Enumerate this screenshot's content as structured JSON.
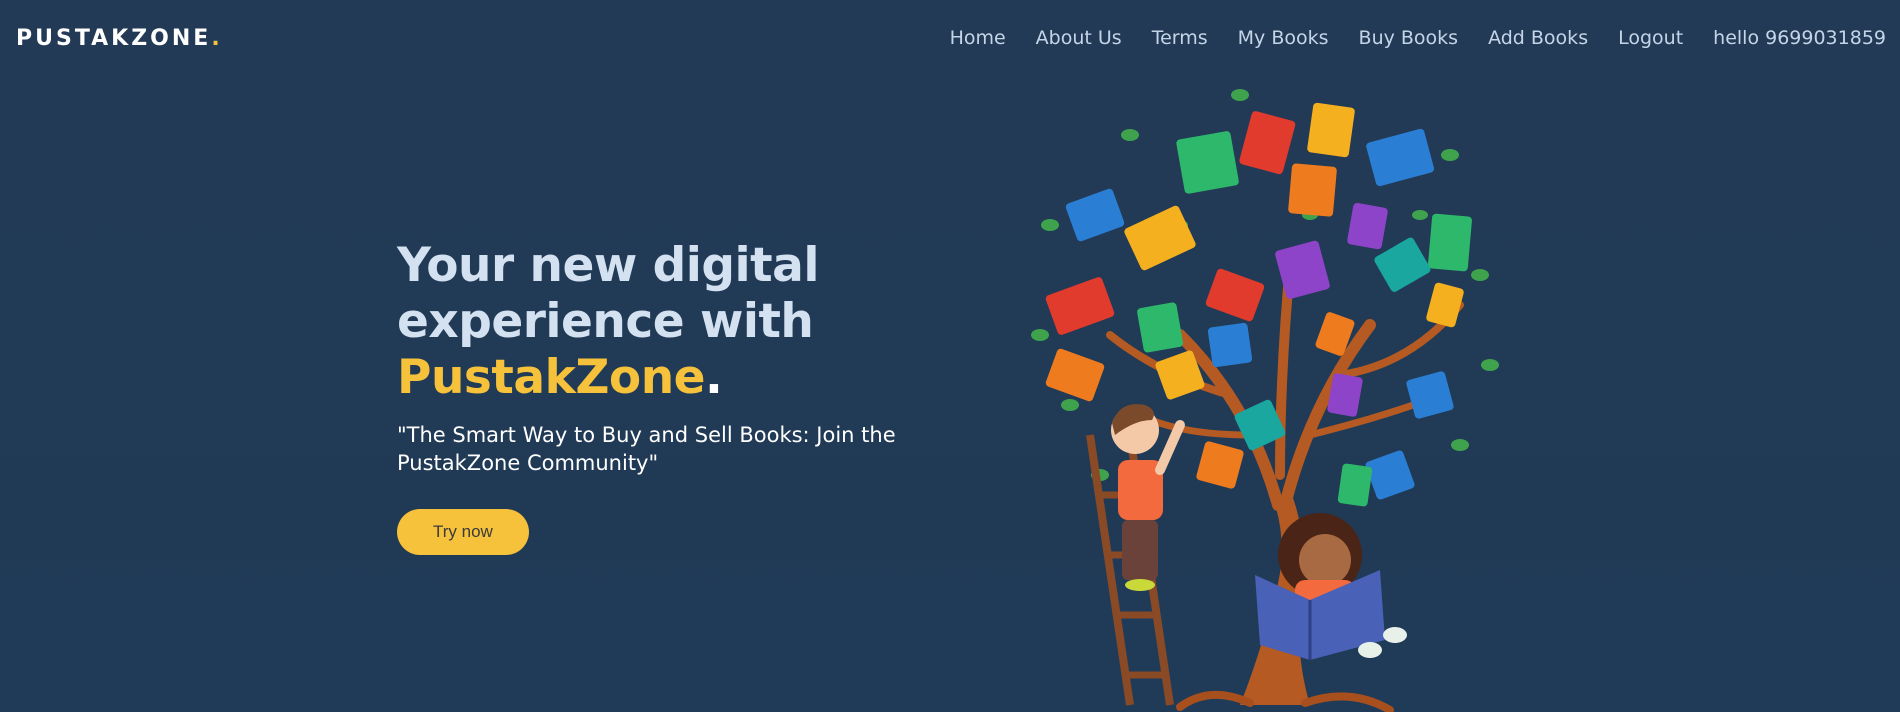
{
  "brand": {
    "name": "PUSTAKZONE",
    "dot": "."
  },
  "nav": {
    "items": [
      {
        "label": "Home"
      },
      {
        "label": "About Us"
      },
      {
        "label": "Terms"
      },
      {
        "label": "My Books"
      },
      {
        "label": "Buy Books"
      },
      {
        "label": "Add Books"
      },
      {
        "label": "Logout"
      }
    ],
    "greeting": "hello 9699031859"
  },
  "hero": {
    "headline_line1": "Your new digital",
    "headline_line2": "experience with",
    "headline_brand": "PustakZone",
    "headline_period": ".",
    "tagline": "\"The Smart Way to Buy and Sell Books: Join the PustakZone Community\"",
    "cta_label": "Try now"
  },
  "colors": {
    "background": "#223a56",
    "accent": "#f6c13b",
    "nav_text": "#c5d5e8",
    "headline": "#d3e1f0"
  }
}
